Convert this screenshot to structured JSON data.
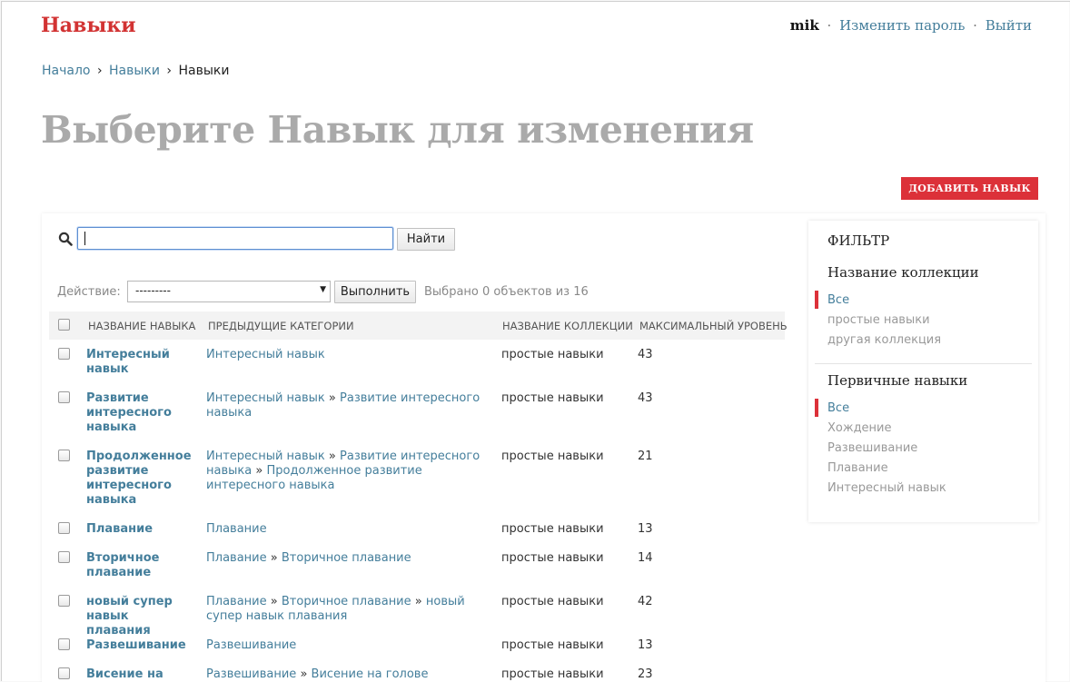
{
  "header": {
    "brand": "Навыки",
    "username": "mik",
    "change_password": "Изменить пароль",
    "logout": "Выйти",
    "separator": "·"
  },
  "breadcrumbs": {
    "items": [
      "Начало",
      "Навыки"
    ],
    "current": "Навыки",
    "separator": "›"
  },
  "title": "Выберите Навык для изменения",
  "add_button": "ДОБАВИТЬ НАВЫК",
  "search": {
    "value": "",
    "button": "Найти",
    "icon": "search-icon"
  },
  "actions": {
    "label": "Действие:",
    "selected": "---------",
    "go_button": "Выполнить",
    "counter": "Выбрано 0 объектов из 16"
  },
  "table": {
    "headers": [
      "НАЗВАНИЕ НАВЫКА",
      "ПРЕДЫДУЩИЕ КАТЕГОРИИ",
      "НАЗВАНИЕ КОЛЛЕКЦИИ",
      "МАКСИМАЛЬНЫЙ УРОВЕНЬ"
    ],
    "rows": [
      {
        "name": "Интересный навык",
        "prev": [
          "Интересный навык"
        ],
        "collection": "простые навыки",
        "level": "43"
      },
      {
        "name": "Развитие интересного навыка",
        "prev": [
          "Интересный навык",
          "Развитие интересного навыка"
        ],
        "collection": "простые навыки",
        "level": "43"
      },
      {
        "name": "Продолженное развитие интересного навыка",
        "prev": [
          "Интересный навык",
          "Развитие интересного навыка",
          "Продолженное развитие интересного навыка"
        ],
        "collection": "простые навыки",
        "level": "21"
      },
      {
        "name": "Плавание",
        "prev": [
          "Плавание"
        ],
        "collection": "простые навыки",
        "level": "13"
      },
      {
        "name": "Вторичное плавание",
        "prev": [
          "Плавание",
          "Вторичное плавание"
        ],
        "collection": "простые навыки",
        "level": "14"
      },
      {
        "name": "новый супер навык плавания",
        "prev": [
          "Плавание",
          "Вторичное плавание",
          "новый супер навык плавания"
        ],
        "collection": "простые навыки",
        "level": "42"
      },
      {
        "name": "Развешивание",
        "prev": [
          "Развешивание"
        ],
        "collection": "простые навыки",
        "level": "13"
      },
      {
        "name": "Висение на",
        "prev": [
          "Развешивание",
          "Висение на голове"
        ],
        "collection": "простые навыки",
        "level": "23"
      }
    ],
    "prev_separator": "»"
  },
  "filter": {
    "title": "ФИЛЬТР",
    "groups": [
      {
        "title": "Название коллекции",
        "items": [
          "Все",
          "простые навыки",
          "другая коллекция"
        ]
      },
      {
        "title": "Первичные навыки",
        "items": [
          "Все",
          "Хождение",
          "Развешивание",
          "Плавание",
          "Интересный навык"
        ]
      }
    ]
  },
  "colors": {
    "accent_red": "#dc3139",
    "link_blue": "#447e9b",
    "title_gray": "#aaaaaa"
  }
}
